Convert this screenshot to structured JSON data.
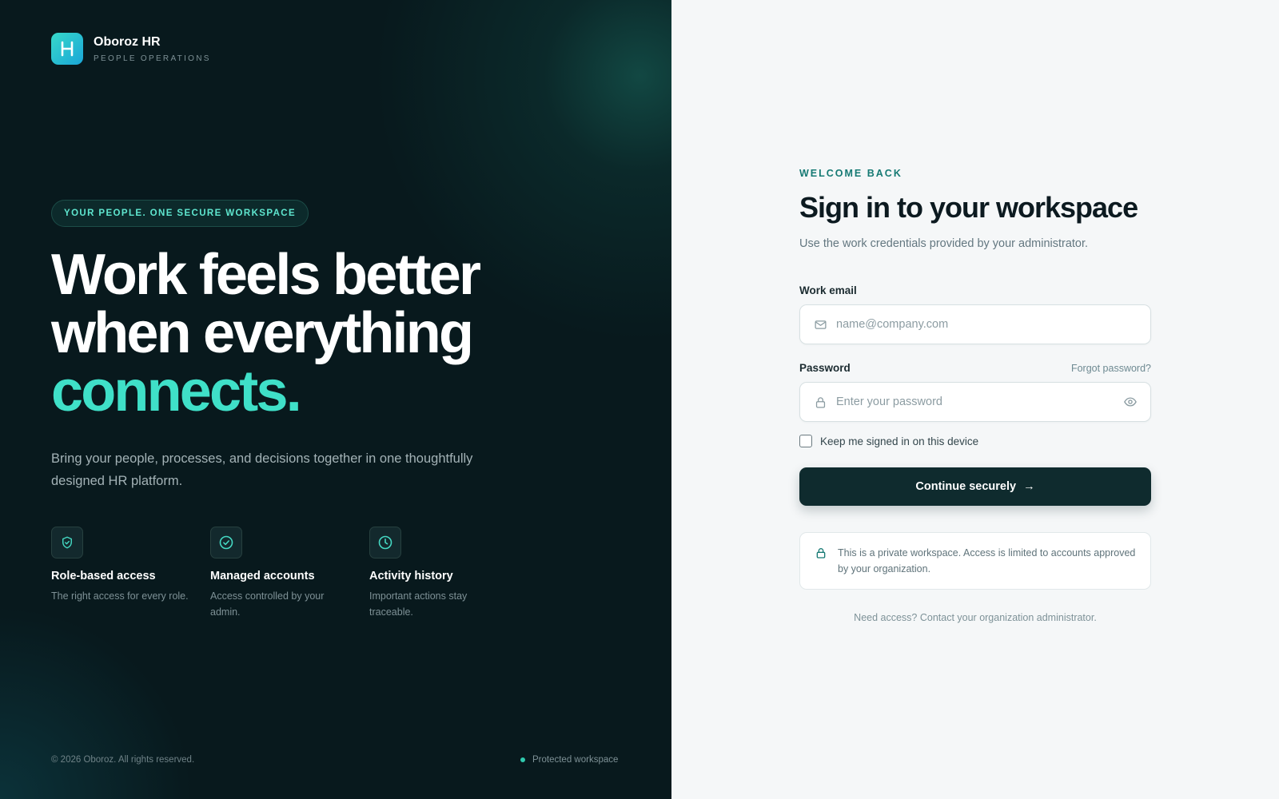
{
  "brand": {
    "logo_letter": "H",
    "name": "Oboroz HR",
    "subtitle": "PEOPLE OPERATIONS"
  },
  "hero": {
    "pill": "YOUR PEOPLE. ONE SECURE WORKSPACE",
    "headline_line1": "Work feels better",
    "headline_line2": "when everything",
    "headline_accent": "connects.",
    "subtext": "Bring your people, processes, and decisions together in one thoughtfully designed HR platform."
  },
  "features": [
    {
      "icon": "shield-check-icon",
      "title": "Role-based access",
      "desc": "The right access for every role."
    },
    {
      "icon": "check-circle-icon",
      "title": "Managed accounts",
      "desc": "Access controlled by your admin."
    },
    {
      "icon": "clock-icon",
      "title": "Activity history",
      "desc": "Important actions stay traceable."
    }
  ],
  "footer": {
    "copyright": "© 2026 Oboroz. All rights reserved.",
    "status": "Protected workspace"
  },
  "form": {
    "eyebrow": "WELCOME BACK",
    "title": "Sign in to your workspace",
    "description": "Use the work credentials provided by your administrator.",
    "email_label": "Work email",
    "email_placeholder": "name@company.com",
    "email_value": "",
    "password_label": "Password",
    "forgot_link": "Forgot password?",
    "password_placeholder": "Enter your password",
    "password_value": "",
    "remember_label": "Keep me signed in on this device",
    "remember_checked": false,
    "submit_label": "Continue securely",
    "submit_arrow": "→",
    "notice": "This is a private workspace. Access is limited to accounts approved by your organization.",
    "help": "Need access? Contact your organization administrator."
  },
  "colors": {
    "left_panel_bg": "#08191d",
    "accent": "#3fe0c8",
    "button_bg": "#0f2b2e",
    "right_panel_bg": "#f5f7f8",
    "eyebrow": "#167a74"
  }
}
